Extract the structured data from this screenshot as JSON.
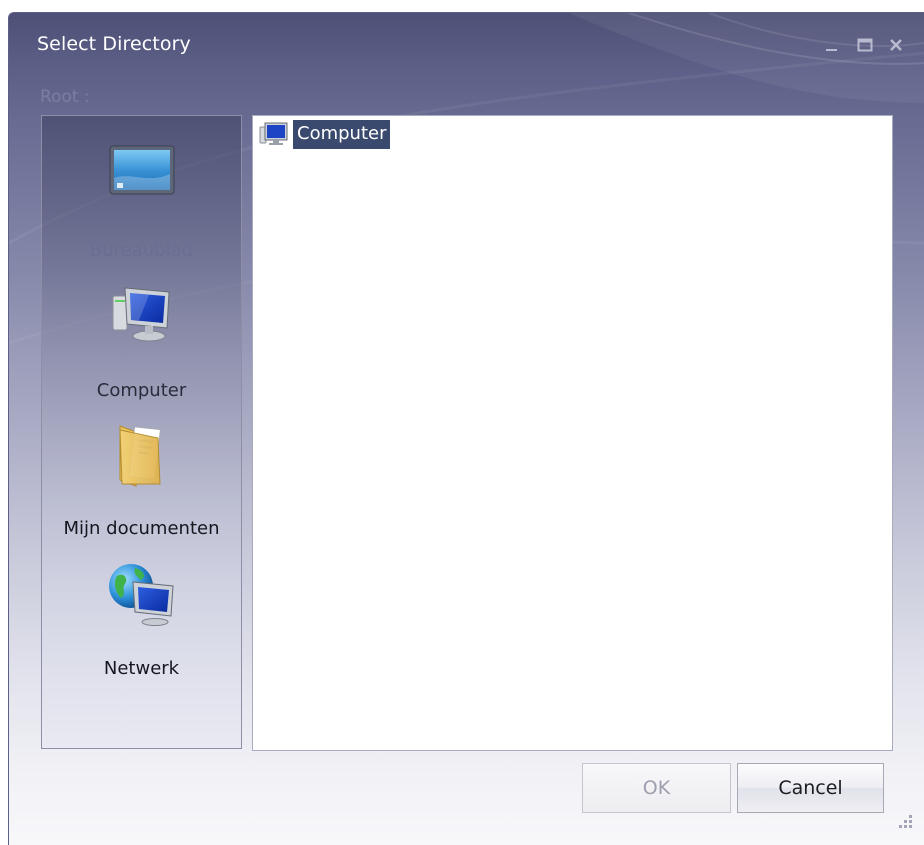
{
  "window": {
    "title": "Select Directory",
    "root_label": "Root :"
  },
  "places": [
    {
      "label": "Bureaublad",
      "icon": "desktop-icon"
    },
    {
      "label": "Computer",
      "icon": "computer-icon"
    },
    {
      "label": "Mijn documenten",
      "icon": "documents-folder-icon"
    },
    {
      "label": "Netwerk",
      "icon": "network-icon"
    }
  ],
  "tree": {
    "nodes": [
      {
        "label": "Computer",
        "icon": "computer-icon",
        "selected": true
      }
    ]
  },
  "buttons": {
    "ok": "OK",
    "cancel": "Cancel"
  },
  "colors": {
    "title_bar": "#4e5076",
    "selection": "#3a4a6e"
  }
}
